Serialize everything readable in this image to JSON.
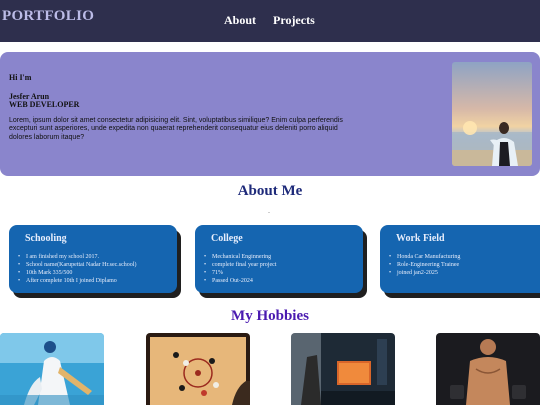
{
  "nav": {
    "brand": "PORTFOLIO",
    "links": [
      "About",
      "Projects"
    ]
  },
  "hero": {
    "greeting": "Hi I'm",
    "name": "Jesfer Arun",
    "role": "WEB DEVELOPER",
    "bio": "Lorem, ipsum dolor sit amet consectetur adipisicing elit. Sint, voluptatibus similique? Enim culpa perferendis excepturi sunt asperiores, unde expedita non quaerat reprehenderit consequatur eius deleniti porro aliquid dolores laborum itaque?"
  },
  "about": {
    "title": "About Me",
    "cards": [
      {
        "title": "Schooling",
        "items": [
          "I am finished my school 2017.",
          "School name(Karupettai Nadar Hr.sec.school)",
          "10th Mark 335/500",
          "After complete 10th I joined Diplamo"
        ]
      },
      {
        "title": "College",
        "items": [
          "Mechanical Enginnering",
          "complete final year project",
          "71%",
          "Passed Out-2024"
        ]
      },
      {
        "title": "Work Field",
        "items": [
          "Honda Car Manufacturing",
          "Role-Engineering Trainee",
          "joined jan2-2025"
        ]
      }
    ]
  },
  "hobbies": {
    "title": "My Hobbies"
  },
  "colors": {
    "navbar": "#2e2f4d",
    "hero": "#8a85cc",
    "card": "#1565b0",
    "about_title": "#1e2a7a",
    "hobbies_title": "#4a1ab0"
  }
}
